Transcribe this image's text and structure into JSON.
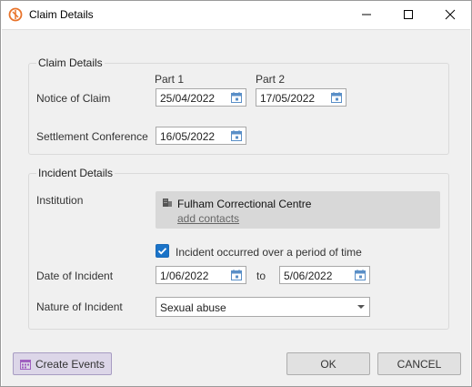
{
  "window": {
    "title": "Claim Details",
    "brand_color": "#e8732a"
  },
  "claim_details": {
    "legend": "Claim Details",
    "part1_label": "Part 1",
    "part2_label": "Part 2",
    "notice_label": "Notice of Claim",
    "notice_part1": "25/04/2022",
    "notice_part2": "17/05/2022",
    "settlement_label": "Settlement Conference",
    "settlement_date": "16/05/2022"
  },
  "incident_details": {
    "legend": "Incident Details",
    "institution_label": "Institution",
    "institution_name": "Fulham Correctional Centre",
    "add_contacts": "add contacts",
    "period_checkbox_label": "Incident occurred over a period of time",
    "period_checked": true,
    "date_label": "Date of Incident",
    "date_from": "1/06/2022",
    "to_label": "to",
    "date_to": "5/06/2022",
    "nature_label": "Nature of Incident",
    "nature_value": "Sexual abuse"
  },
  "footer": {
    "create_events": "Create Events",
    "ok": "OK",
    "cancel": "CANCEL"
  }
}
